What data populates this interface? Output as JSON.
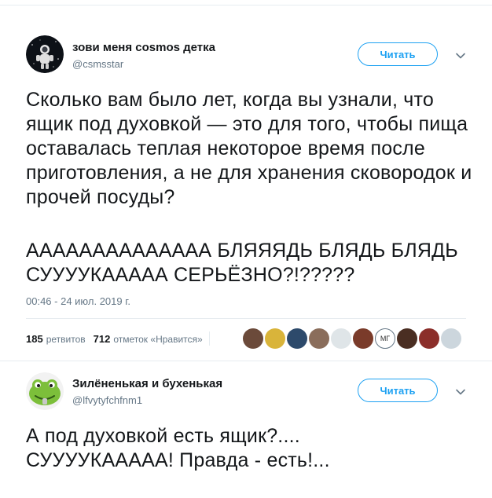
{
  "tweet1": {
    "display_name": "зови меня cosmos детка",
    "handle": "@csmsstar",
    "follow_label": "Читать",
    "text_para1": "Сколько вам было лет, когда вы узнали, что ящик под духовкой — это для того, чтобы пища оставалась теплая некоторое время после приготовления, а не для хранения сковородок и прочей посуды?",
    "text_para2": "АААААААААААААА БЛЯЯЯДЬ БЛЯДЬ БЛЯДЬ СУУУУКААААА СЕРЬЁЗНО?!?????",
    "timestamp": "00:46 - 24 июл. 2019 г.",
    "retweets_count": "185",
    "retweets_label": "ретвитов",
    "likes_count": "712",
    "likes_label": "отметок «Нравится»",
    "liker_avatars": [
      {
        "icon": "bearded-man-avatar",
        "color": "#6b4a3a"
      },
      {
        "icon": "cartoon-avatar",
        "color": "#d9b43a"
      },
      {
        "icon": "dark-figure-avatar",
        "color": "#2d4a6b"
      },
      {
        "icon": "woman-avatar",
        "color": "#8a6d5b"
      },
      {
        "icon": "penguin-avatar",
        "color": "#dfe5e8"
      },
      {
        "icon": "sunset-avatar",
        "color": "#7a3b2a"
      },
      {
        "icon": "monogram-avatar",
        "color": "#ffffff",
        "text": "МГ"
      },
      {
        "icon": "dark-hair-avatar",
        "color": "#4a2e22"
      },
      {
        "icon": "red-figure-avatar",
        "color": "#8b2e2a"
      },
      {
        "icon": "default-user-avatar",
        "color": "#ccd6dd"
      }
    ]
  },
  "tweet2": {
    "display_name": "Зилёненькая и бухенькая",
    "handle": "@lfvytyfchfnm1",
    "follow_label": "Читать",
    "text": "А под духовкой есть ящик?....\nСУУУУКААААА! Правда - есть!..."
  },
  "colors": {
    "accent": "#1da1f2",
    "secondary_text": "#657786",
    "divider": "#e6ecf0"
  }
}
